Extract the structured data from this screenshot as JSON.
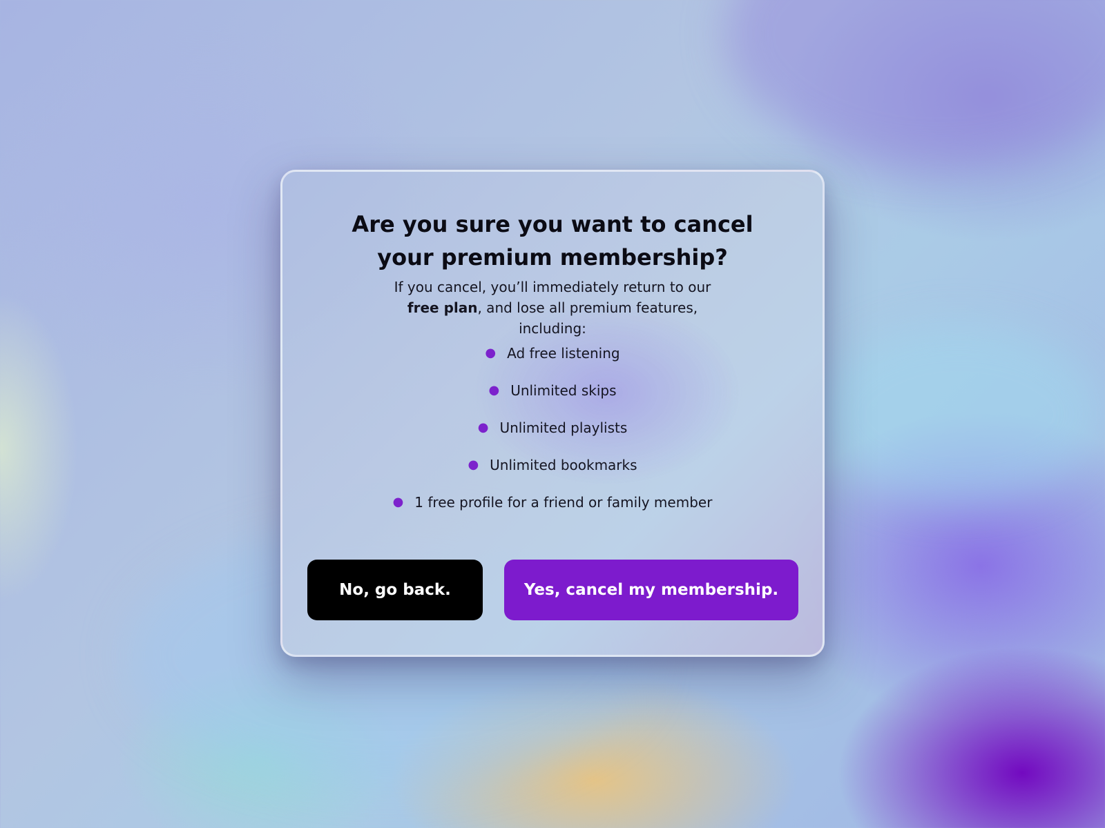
{
  "dialog": {
    "title": "Are you sure you want to cancel your premium membership?",
    "description": {
      "before": "If you cancel, you’ll immediately return to our ",
      "emphasis": "free plan",
      "after": ", and lose all premium features, including:"
    },
    "features": [
      "Ad free listening",
      "Unlimited skips",
      "Unlimited playlists",
      "Unlimited bookmarks",
      "1 free profile for a friend or family member"
    ],
    "buttons": {
      "back_label": "No, go back.",
      "cancel_label": "Yes, cancel my membership."
    }
  },
  "colors": {
    "accent": "#7d1bcd",
    "bullet": "#7c22cc",
    "back_button": "#000000",
    "button_text": "#ffffff"
  },
  "icons": {
    "bullet": "bullet-dot-icon"
  }
}
